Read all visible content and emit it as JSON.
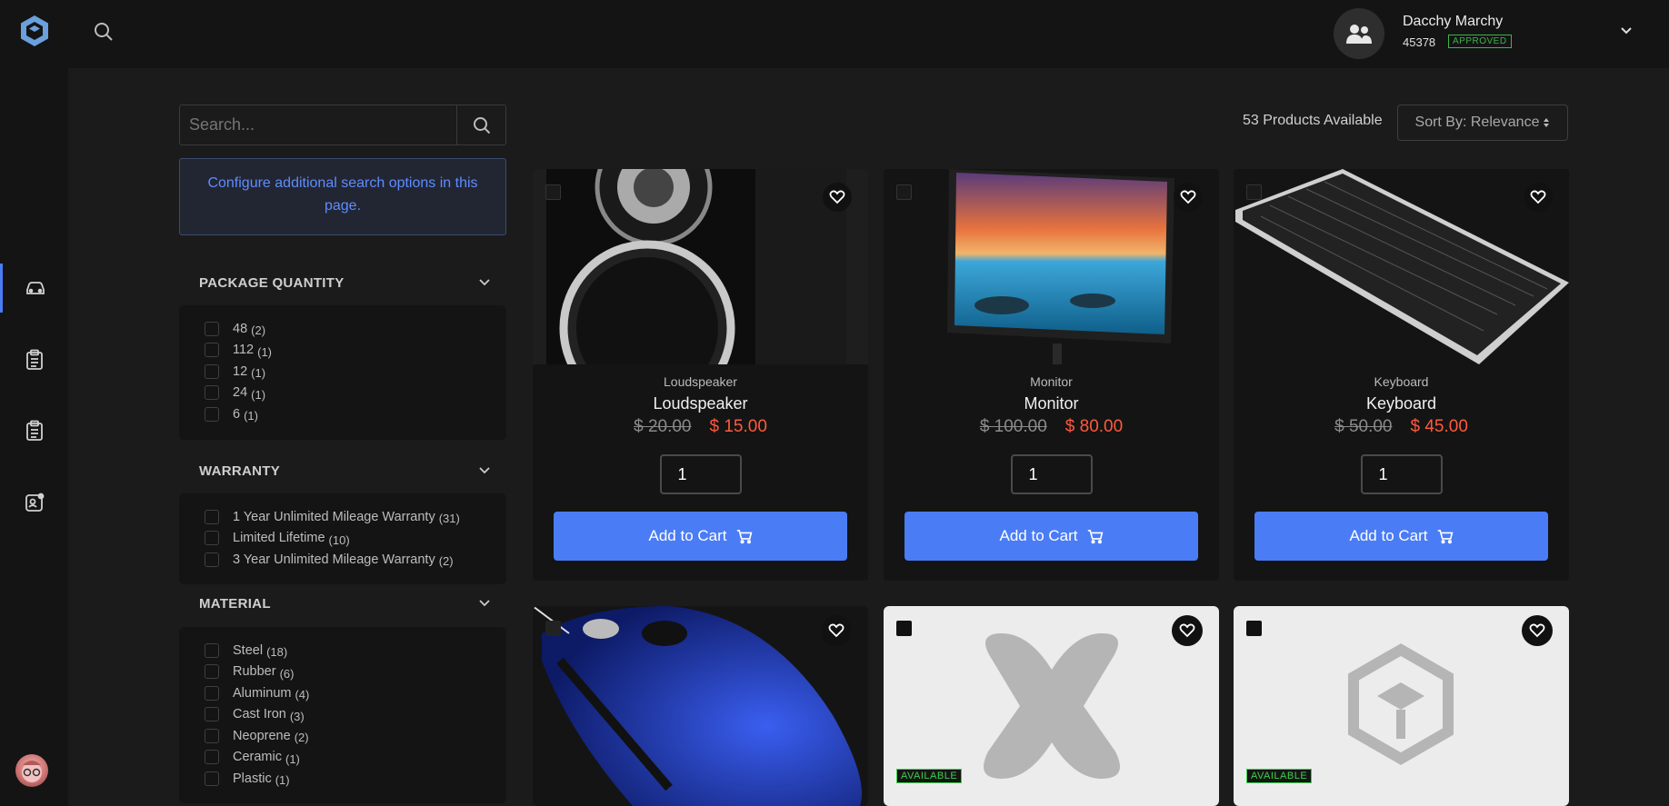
{
  "header": {
    "user_name": "Dacchy Marchy",
    "user_id": "45378",
    "user_status": "APPROVED"
  },
  "rail": {
    "items": [
      {
        "icon": "car-icon",
        "active": true
      },
      {
        "icon": "clipboard-list-icon",
        "active": false
      },
      {
        "icon": "clipboard-list-icon",
        "active": false
      },
      {
        "icon": "profile-notification-icon",
        "active": false
      }
    ]
  },
  "sidebar": {
    "search_placeholder": "Search...",
    "config_text": "Configure additional search options in this page.",
    "facets": [
      {
        "title": "PACKAGE QUANTITY",
        "options": [
          {
            "label": "48",
            "count": "(2)"
          },
          {
            "label": "112",
            "count": "(1)"
          },
          {
            "label": "12",
            "count": "(1)"
          },
          {
            "label": "24",
            "count": "(1)"
          },
          {
            "label": "6",
            "count": "(1)"
          }
        ]
      },
      {
        "title": "WARRANTY",
        "options": [
          {
            "label": "1 Year Unlimited Mileage Warranty",
            "count": "(31)"
          },
          {
            "label": "Limited Lifetime",
            "count": "(10)"
          },
          {
            "label": "3 Year Unlimited Mileage Warranty",
            "count": "(2)"
          }
        ]
      },
      {
        "title": "MATERIAL",
        "options": [
          {
            "label": "Steel",
            "count": "(18)"
          },
          {
            "label": "Rubber",
            "count": "(6)"
          },
          {
            "label": "Aluminum",
            "count": "(4)"
          },
          {
            "label": "Cast Iron",
            "count": "(3)"
          },
          {
            "label": "Neoprene",
            "count": "(2)"
          },
          {
            "label": "Ceramic",
            "count": "(1)"
          },
          {
            "label": "Plastic",
            "count": "(1)"
          }
        ]
      }
    ]
  },
  "main": {
    "product_count": "53 Products Available",
    "sort_label": "Sort By: Relevance",
    "products": [
      {
        "category": "Loudspeaker",
        "name": "Loudspeaker",
        "old_price": "$ 20.00",
        "new_price": "$ 15.00",
        "qty": "1",
        "add_label": "Add to Cart"
      },
      {
        "category": "Monitor",
        "name": "Monitor",
        "old_price": "$ 100.00",
        "new_price": "$ 80.00",
        "qty": "1",
        "add_label": "Add to Cart"
      },
      {
        "category": "Keyboard",
        "name": "Keyboard",
        "old_price": "$ 50.00",
        "new_price": "$ 45.00",
        "qty": "1",
        "add_label": "Add to Cart"
      }
    ],
    "second_row": [
      {
        "image": "mouse",
        "available": ""
      },
      {
        "image": "placeholder-x",
        "available": "AVAILABLE"
      },
      {
        "image": "placeholder-cube",
        "available": "AVAILABLE"
      }
    ]
  },
  "colors": {
    "accent": "#4a7cf6",
    "sale_price": "#ff5a3c",
    "approved": "#3bb54a"
  }
}
